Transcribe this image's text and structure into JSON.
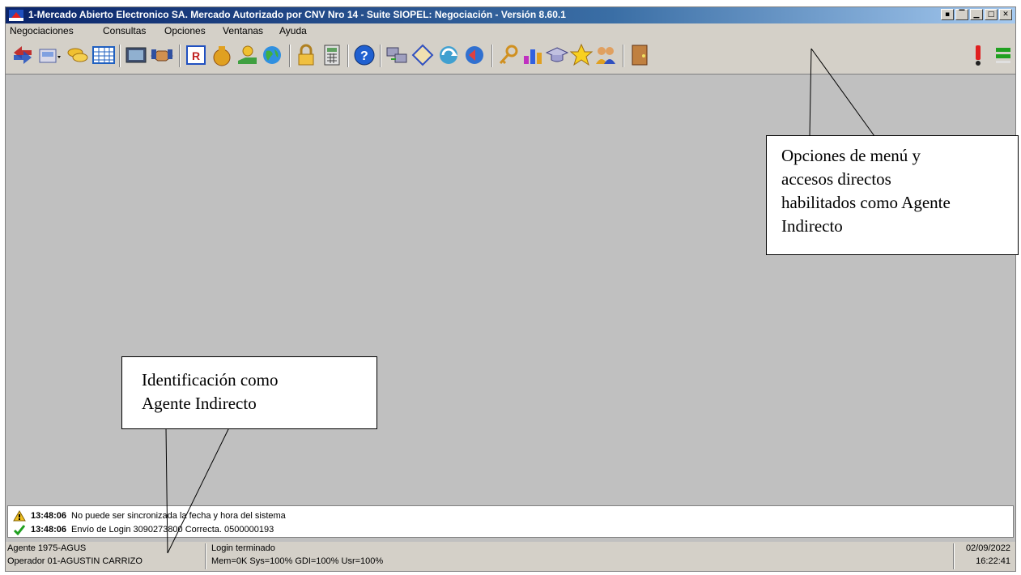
{
  "window": {
    "title": "1-Mercado Abierto Electronico SA. Mercado Autorizado por CNV Nro 14 - Suite SIOPEL: Negociación - Versión 8.60.1",
    "buttons": [
      "minimize-to-tray",
      "minimize",
      "restore",
      "maximize",
      "close"
    ]
  },
  "menu": {
    "items": [
      "Negociaciones",
      "Consultas",
      "Opciones",
      "Ventanas",
      "Ayuda"
    ]
  },
  "toolbar": {
    "icons": [
      "exchange-icon",
      "register-icon",
      "coins-icon",
      "calendar-grid-icon",
      "screen-icon",
      "handshake-icon",
      "report-r-icon",
      "money-bag-icon",
      "hand-money-icon",
      "globe-icon",
      "lock-icon",
      "calculator-icon",
      "help-icon",
      "transfer-icon",
      "diamond-icon",
      "refresh-icon",
      "return-icon",
      "key-icon",
      "bar-chart-icon",
      "graduation-icon",
      "star-icon",
      "users-icon",
      "exit-door-icon",
      "alert-icon",
      "connection-status-icon"
    ]
  },
  "callouts": {
    "menu_note": [
      "Opciones de menú y",
      "accesos directos",
      "habilitados como Agente",
      "Indirecto"
    ],
    "agent_note": [
      "Identificación como",
      "Agente Indirecto"
    ]
  },
  "log": {
    "rows": [
      {
        "icon": "warning-icon",
        "time": "13:48:06",
        "text": "No puede ser sincronizada la fecha y hora del sistema"
      },
      {
        "icon": "check-icon",
        "time": "13:48:06",
        "text": "Envío de Login 3090273800 Correcta. 0500000193"
      }
    ]
  },
  "status": {
    "agent": "Agente 1975-AGUS",
    "operator": "Operador 01-AGUSTIN CARRIZO",
    "login_state": "Login terminado",
    "resources": "Mem=0K Sys=100% GDI=100% Usr=100%",
    "date": "02/09/2022",
    "time": "16:22:41"
  },
  "colors": {
    "titlebar": "#0a246a",
    "workspace": "#c0c0c0"
  }
}
